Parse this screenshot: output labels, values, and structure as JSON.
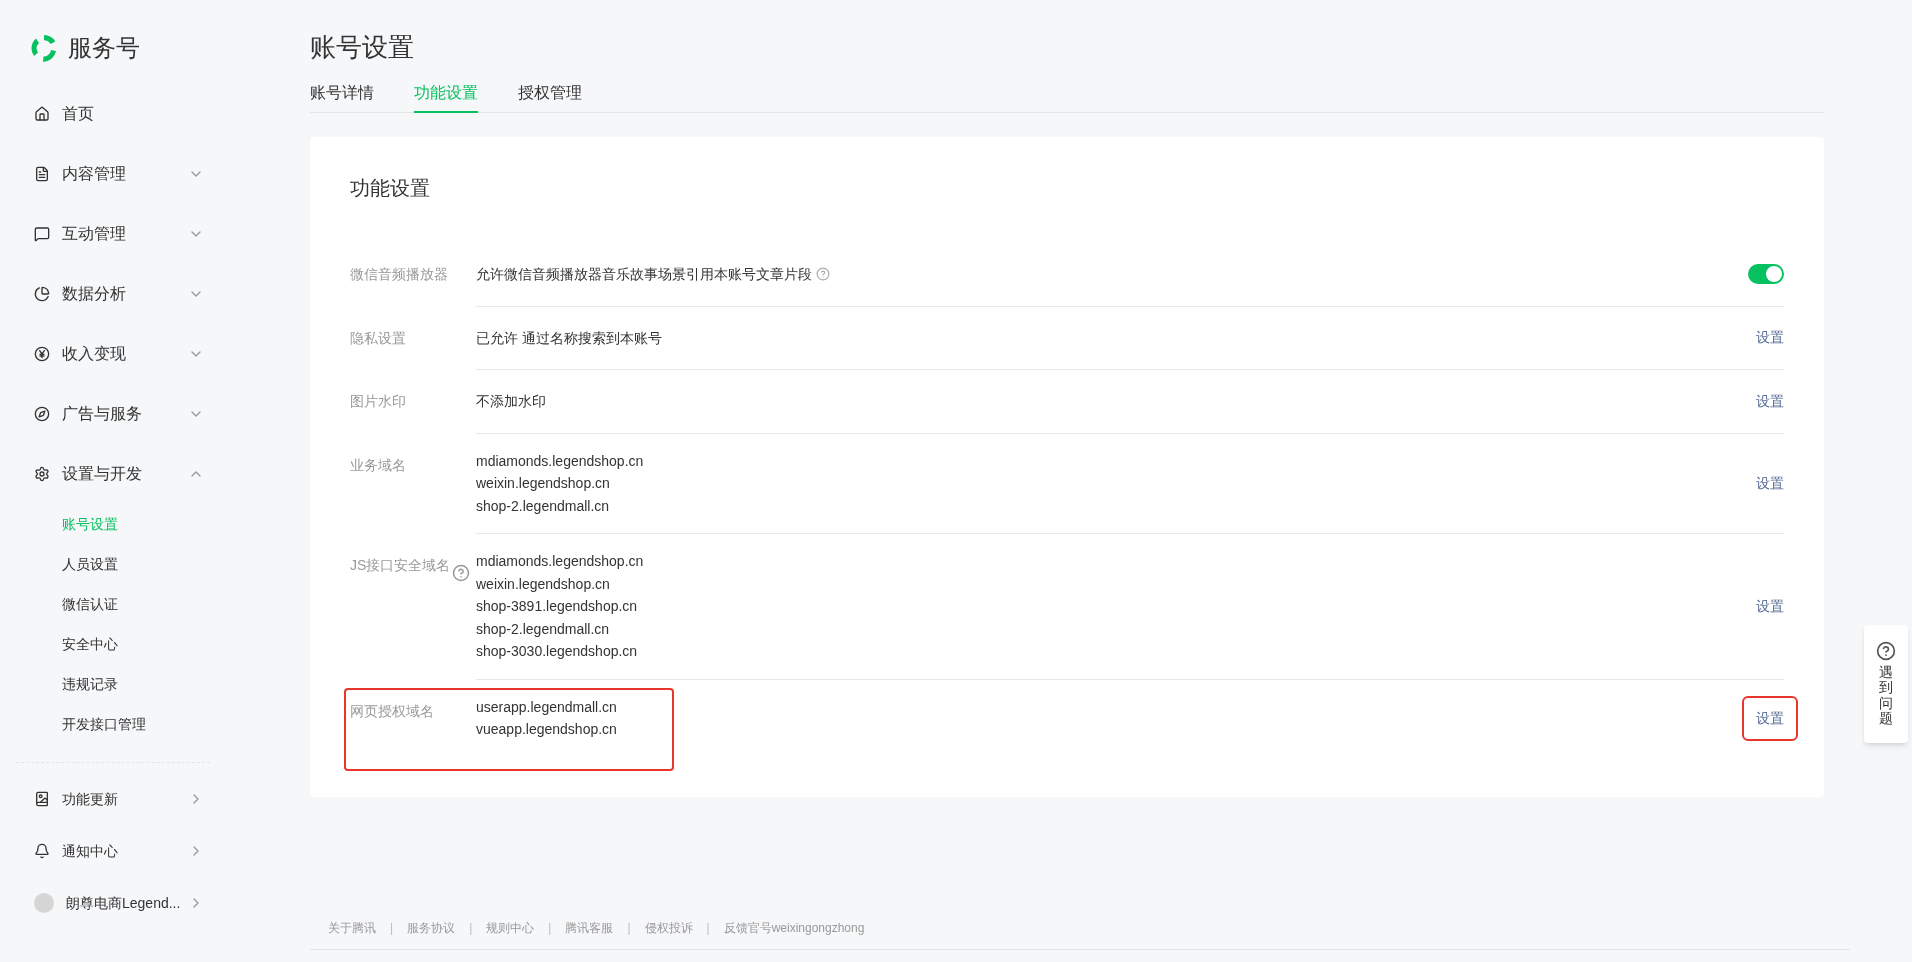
{
  "sidebar": {
    "brand": "服务号",
    "items": [
      {
        "label": "首页",
        "kind": "link"
      },
      {
        "label": "内容管理",
        "kind": "group",
        "expanded": false
      },
      {
        "label": "互动管理",
        "kind": "group",
        "expanded": false
      },
      {
        "label": "数据分析",
        "kind": "group",
        "expanded": false
      },
      {
        "label": "收入变现",
        "kind": "group",
        "expanded": false
      },
      {
        "label": "广告与服务",
        "kind": "group",
        "expanded": false
      },
      {
        "label": "设置与开发",
        "kind": "group",
        "expanded": true,
        "children": [
          {
            "label": "账号设置",
            "selected": true
          },
          {
            "label": "人员设置",
            "selected": false
          },
          {
            "label": "微信认证",
            "selected": false
          },
          {
            "label": "安全中心",
            "selected": false
          },
          {
            "label": "违规记录",
            "selected": false
          },
          {
            "label": "开发接口管理",
            "selected": false
          }
        ]
      }
    ],
    "bottom_items": [
      {
        "label": "功能更新"
      },
      {
        "label": "通知中心"
      },
      {
        "label": "朗尊电商Legend..."
      }
    ]
  },
  "page": {
    "title": "账号设置",
    "tabs": [
      {
        "label": "账号详情",
        "selected": false
      },
      {
        "label": "功能设置",
        "selected": true
      },
      {
        "label": "授权管理",
        "selected": false
      }
    ]
  },
  "card": {
    "title": "功能设置",
    "rows": [
      {
        "label": "微信音频播放器",
        "label_help": false,
        "values": [
          "允许微信音频播放器音乐故事场景引用本账号文章片段"
        ],
        "value_help": true,
        "kind": "toggle",
        "on": true,
        "highlighted": false
      },
      {
        "label": "隐私设置",
        "label_help": false,
        "values": [
          "已允许 通过名称搜索到本账号"
        ],
        "value_help": false,
        "kind": "link",
        "action": "设置",
        "highlighted": false,
        "action_highlighted": false
      },
      {
        "label": "图片水印",
        "label_help": false,
        "values": [
          "不添加水印"
        ],
        "value_help": false,
        "kind": "link",
        "action": "设置",
        "highlighted": false,
        "action_highlighted": false
      },
      {
        "label": "业务域名",
        "label_help": false,
        "values": [
          "mdiamonds.legendshop.cn",
          "weixin.legendshop.cn",
          "shop-2.legendmall.cn"
        ],
        "value_help": false,
        "kind": "link",
        "action": "设置",
        "highlighted": false,
        "action_highlighted": false
      },
      {
        "label": "JS接口安全域名",
        "label_help": true,
        "values": [
          "mdiamonds.legendshop.cn",
          "weixin.legendshop.cn",
          "shop-3891.legendshop.cn",
          "shop-2.legendmall.cn",
          "shop-3030.legendshop.cn"
        ],
        "value_help": false,
        "kind": "link",
        "action": "设置",
        "highlighted": false,
        "action_highlighted": false
      },
      {
        "label": "网页授权域名",
        "label_help": false,
        "values": [
          "userapp.legendmall.cn",
          "vueapp.legendshop.cn"
        ],
        "value_help": false,
        "kind": "link",
        "action": "设置",
        "highlighted": true,
        "action_highlighted": true
      }
    ]
  },
  "footer": {
    "links": [
      "关于腾讯",
      "服务协议",
      "规则中心",
      "腾讯客服",
      "侵权投诉",
      "反馈官号weixingongzhong"
    ],
    "separator": "|"
  },
  "help_button": {
    "label": "遇到问题"
  }
}
